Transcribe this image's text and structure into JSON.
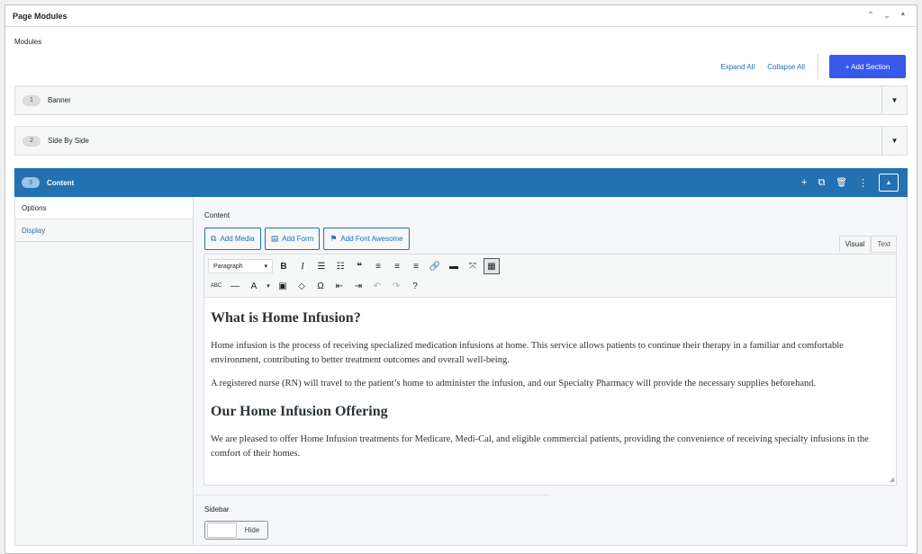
{
  "metabox": {
    "title": "Page Modules",
    "controls": {
      "up_icon": "⌃",
      "down_icon": "⌄",
      "toggle_icon": "▲"
    }
  },
  "modules_label": "Modules",
  "actions": {
    "expand_all": "Expand All",
    "collapse_all": "Collapse All",
    "add_section": "+ Add Section"
  },
  "rows": [
    {
      "number": "1",
      "label": "Banner",
      "toggle": "▼"
    },
    {
      "number": "2",
      "label": "Side By Side",
      "toggle": "▼"
    }
  ],
  "active_module": {
    "number": "3",
    "label": "Content",
    "icons": {
      "add": "+",
      "duplicate": "⧉",
      "delete": "🗑",
      "more": "⋮",
      "collapse": "▲"
    },
    "tabs": [
      "Options",
      "Display"
    ],
    "content_label": "Content",
    "media_buttons": [
      "Add Media",
      "Add Form",
      "Add Font Awesome"
    ],
    "editor_tabs": [
      "Visual",
      "Text"
    ],
    "format_select": "Paragraph",
    "document": {
      "heading1": "What is Home Infusion?",
      "para1": "Home infusion is the process of receiving specialized medication infusions at home. This service allows patients to continue their therapy in a familiar and comfortable environment, contributing to better treatment outcomes and overall well-being.",
      "para2": "A registered nurse (RN) will travel to the patient’s home to administer the infusion, and our Specialty Pharmacy will provide the necessary supplies beforehand.",
      "heading2": "Our Home Infusion Offering",
      "para3": "We are pleased to offer Home Infusion treatments for Medicare, Medi-Cal, and eligible commercial patients, providing the convenience of receiving specialty infusions in the comfort of their homes."
    },
    "sidebar_label": "Sidebar",
    "sidebar_toggle": "Hide"
  },
  "colors": {
    "accent": "#2271b1",
    "primary_button": "#3858e9"
  }
}
